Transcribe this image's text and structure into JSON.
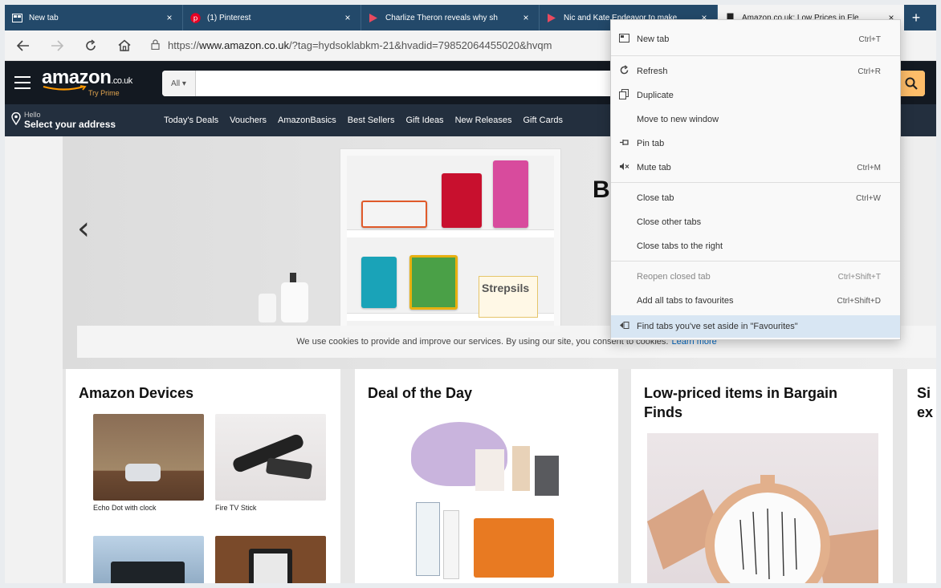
{
  "tabs": [
    {
      "title": "New tab",
      "icon": "newtab-icon",
      "close": "×",
      "active": false
    },
    {
      "title": "(1) Pinterest",
      "icon": "pinterest-icon",
      "close": "×",
      "active": false
    },
    {
      "title": "Charlize Theron reveals why sh",
      "icon": "favicon-icon",
      "close": "×",
      "active": false
    },
    {
      "title": "Nic and Kate Endeavor to make",
      "icon": "favicon-icon",
      "close": "×",
      "active": false
    },
    {
      "title": "Amazon.co.uk: Low Prices in Ele",
      "icon": "page-icon",
      "close": "×",
      "active": true
    }
  ],
  "new_tab_symbol": "+",
  "address_bar": {
    "url_prefix": "https://",
    "url_host": "www.amazon.co.uk",
    "url_rest": "/?tag=hydsoklabkm-21&hvadid=79852064455020&hvqm"
  },
  "amazon": {
    "logo_word": "amazon",
    "logo_tld": ".co.uk",
    "logo_sub": "Try Prime",
    "search_category": "All ▾",
    "deliver_line1": "Hello",
    "deliver_line2": "Select your address",
    "nav_links": [
      "Today's Deals",
      "Vouchers",
      "AmazonBasics",
      "Best Sellers",
      "Gift Ideas",
      "New Releases",
      "Gift Cards"
    ]
  },
  "hero": {
    "letter": "B",
    "product_label": "Strepsils"
  },
  "cookie_notice": {
    "text": "We use cookies to provide and improve our services. By using our site, you consent to cookies.",
    "link": "Learn more"
  },
  "cards": {
    "devices": {
      "title": "Amazon Devices",
      "items": [
        "Echo Dot with clock",
        "Fire TV Stick"
      ]
    },
    "deal": {
      "title": "Deal of the Day"
    },
    "bargain": {
      "title": "Low-priced items in Bargain Finds"
    },
    "partial": {
      "title": "Si ex"
    }
  },
  "context_menu": {
    "items": [
      {
        "label": "New tab",
        "shortcut": "Ctrl+T",
        "icon": "newtab-icon"
      },
      {
        "label": "Refresh",
        "shortcut": "Ctrl+R",
        "icon": "refresh-icon"
      },
      {
        "label": "Duplicate",
        "shortcut": "",
        "icon": "duplicate-icon"
      },
      {
        "label": "Move to new window",
        "shortcut": "",
        "icon": ""
      },
      {
        "label": "Pin tab",
        "shortcut": "",
        "icon": "pin-icon"
      },
      {
        "label": "Mute tab",
        "shortcut": "Ctrl+M",
        "icon": "mute-icon"
      },
      {
        "label": "Close tab",
        "shortcut": "Ctrl+W",
        "icon": ""
      },
      {
        "label": "Close other tabs",
        "shortcut": "",
        "icon": ""
      },
      {
        "label": "Close tabs to the right",
        "shortcut": "",
        "icon": ""
      },
      {
        "label": "Reopen closed tab",
        "shortcut": "Ctrl+Shift+T",
        "icon": ""
      },
      {
        "label": "Add all tabs to favourites",
        "shortcut": "Ctrl+Shift+D",
        "icon": ""
      },
      {
        "label": "Find tabs you've set aside in \"Favourites\"",
        "shortcut": "",
        "icon": "setaside-icon"
      }
    ]
  },
  "colors": {
    "tab_strip": "#23496a",
    "amazon_dark": "#131921",
    "amazon_nav": "#232f3e",
    "amazon_orange": "#febd69",
    "menu_highlight": "#d8e6f3"
  }
}
